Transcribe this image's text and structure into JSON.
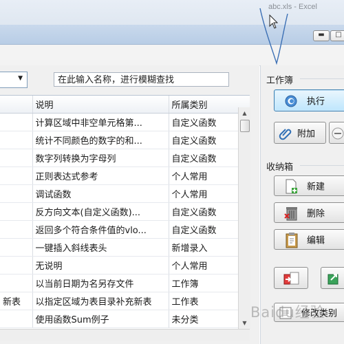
{
  "window": {
    "title": "abc.xls - Excel"
  },
  "search": {
    "placeholder": "在此输入名称，进行模糊查找"
  },
  "table": {
    "columns": [
      "说明",
      "所属类别"
    ],
    "rows": [
      {
        "prefix": "",
        "desc": "计算区域中非空单元格第...",
        "category": "自定义函数"
      },
      {
        "prefix": "",
        "desc": "统计不同颜色的数字的和...",
        "category": "自定义函数"
      },
      {
        "prefix": "",
        "desc": "数字列转换为字母列",
        "category": "自定义函数"
      },
      {
        "prefix": "",
        "desc": "正则表达式参考",
        "category": "个人常用"
      },
      {
        "prefix": "",
        "desc": "调试函数",
        "category": "个人常用"
      },
      {
        "prefix": "",
        "desc": "反方向文本(自定义函数)...",
        "category": "自定义函数"
      },
      {
        "prefix": "",
        "desc": "返回多个符合条件值的vlo...",
        "category": "自定义函数"
      },
      {
        "prefix": "",
        "desc": "一键插入斜线表头",
        "category": "新增录入"
      },
      {
        "prefix": "",
        "desc": "无说明",
        "category": "个人常用"
      },
      {
        "prefix": "",
        "desc": "以当前日期为名另存文件",
        "category": "工作簿"
      },
      {
        "prefix": "新表",
        "desc": "以指定区域为表目录补充新表",
        "category": "工作表"
      },
      {
        "prefix": "",
        "desc": "使用函数Sum例子",
        "category": "未分类"
      }
    ]
  },
  "workbook_group": {
    "label": "工作簿",
    "execute_label": "执行",
    "attach_label": "附加"
  },
  "storage_group": {
    "label": "收纳箱",
    "new_label": "新建",
    "delete_label": "删除",
    "edit_label": "编辑",
    "modify_category_label": "修改类别"
  },
  "watermark": "Baidu经验",
  "colors": {
    "selection_blue": "#bee6fd",
    "titlebar_band": "#c9d9ec"
  }
}
